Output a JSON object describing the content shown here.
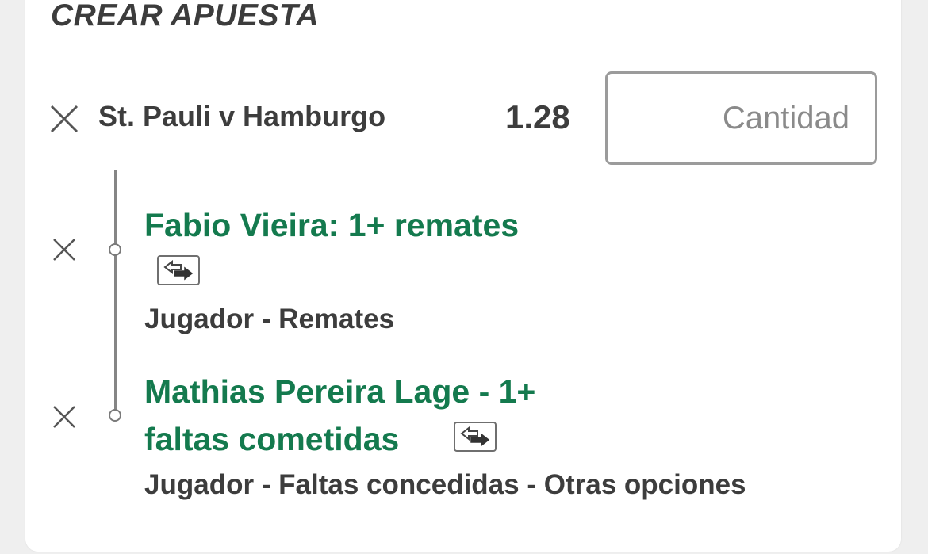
{
  "header": {
    "title": "CREAR APUESTA"
  },
  "bet": {
    "match": "St. Pauli v Hamburgo",
    "odds": "1.28",
    "stake_placeholder": "Cantidad",
    "stake_value": ""
  },
  "selections": [
    {
      "title": "Fabio Vieira: 1+ remates",
      "market": "Jugador - Remates",
      "icon": "bet-builder-swap-icon"
    },
    {
      "title_line1": "Mathias Pereira Lage - 1+",
      "title_line2": "faltas cometidas",
      "market": "Jugador - Faltas concedidas - Otras opciones",
      "icon": "bet-builder-swap-icon"
    }
  ],
  "colors": {
    "selection_text": "#147a4e",
    "primary_text": "#3d3d3d",
    "input_border": "#9b9b9b",
    "background": "#efefef"
  }
}
